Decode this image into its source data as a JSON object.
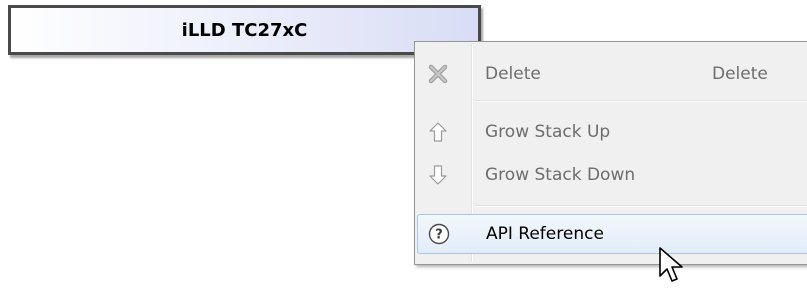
{
  "component": {
    "title": "iLLD TC27xC"
  },
  "context_menu": {
    "items": [
      {
        "label": "Delete",
        "shortcut": "Delete",
        "icon": "delete-x-icon",
        "enabled": false
      },
      {
        "label": "Grow Stack Up",
        "icon": "arrow-up-icon",
        "enabled": false
      },
      {
        "label": "Grow Stack Down",
        "icon": "arrow-down-icon",
        "enabled": false
      },
      {
        "label": "API Reference",
        "icon": "help-circle-icon",
        "enabled": true,
        "hovered": true
      }
    ]
  },
  "colors": {
    "menu_background": "#f0f0f0",
    "highlight_border": "#a8c6ea",
    "disabled_text": "#6d6d6d"
  }
}
